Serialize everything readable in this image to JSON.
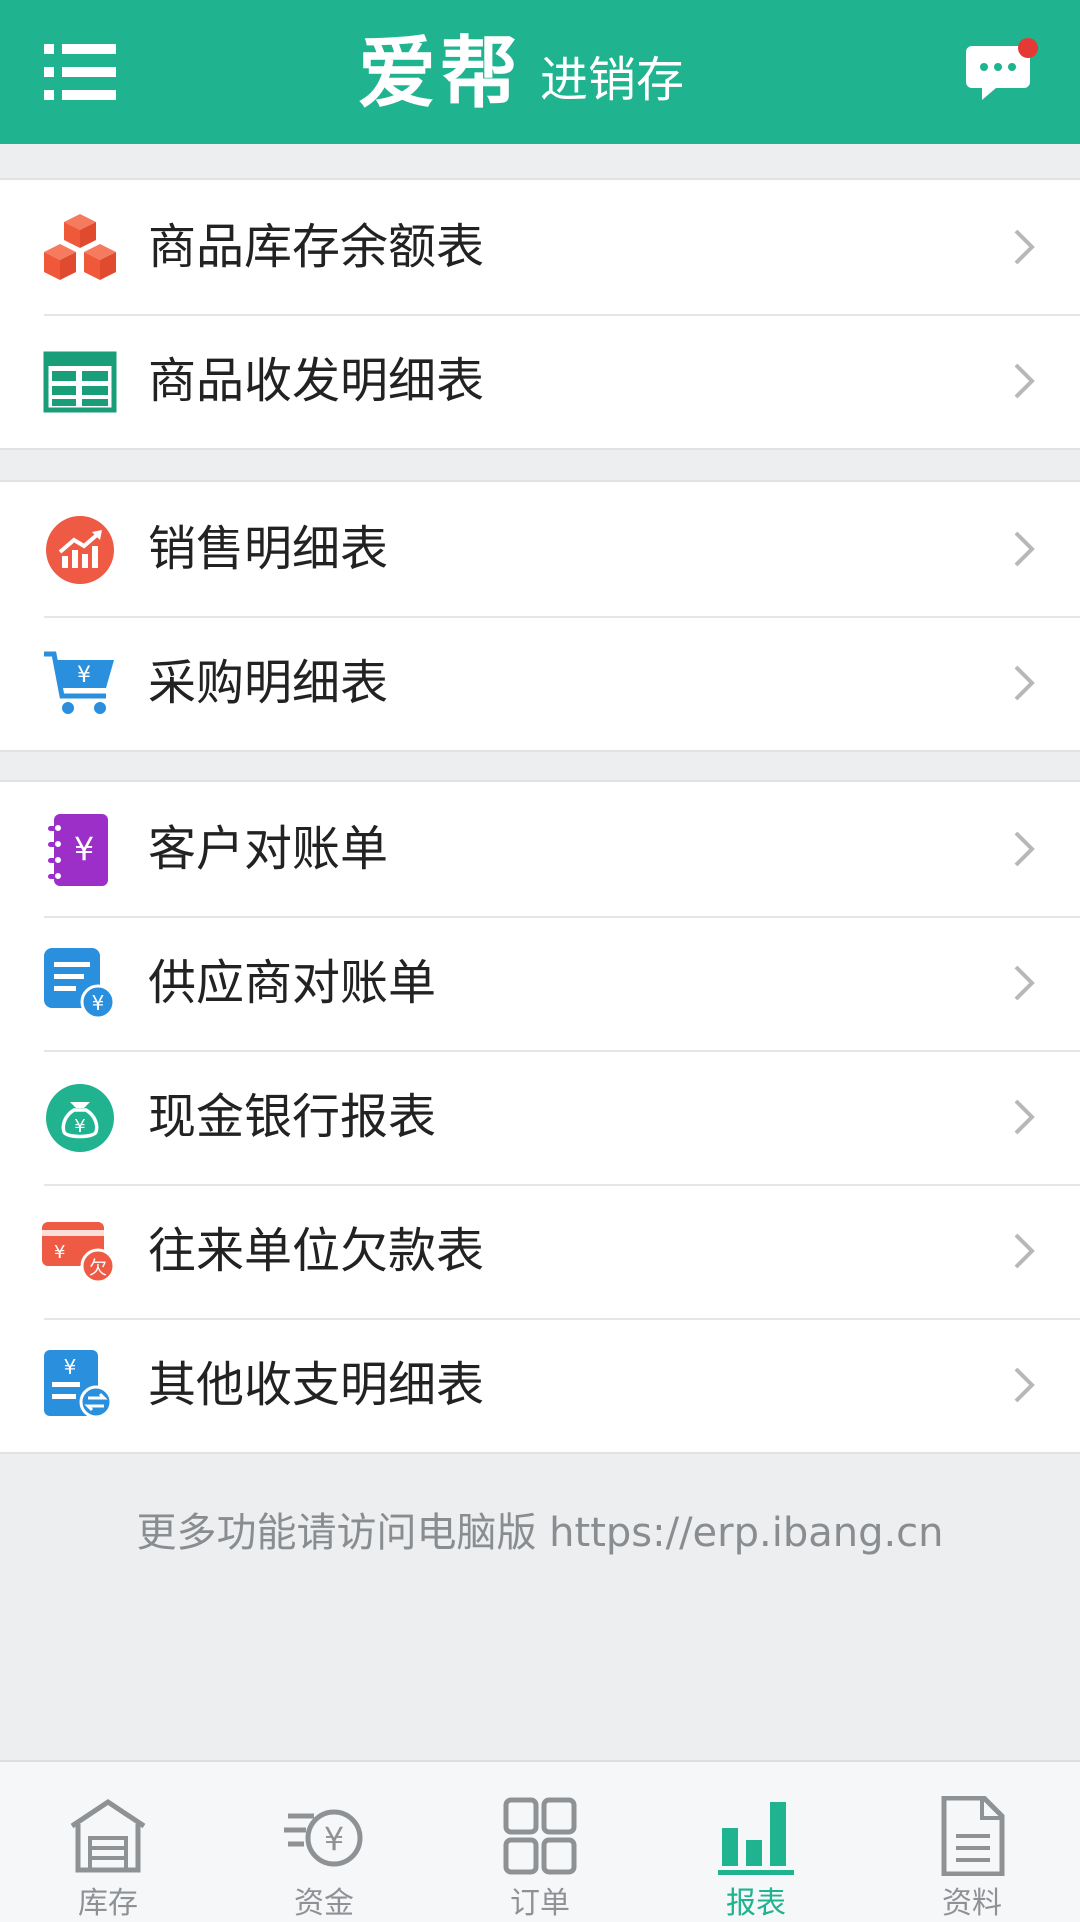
{
  "header": {
    "brand": "爱帮",
    "subtitle": "进销存",
    "has_unread": true
  },
  "groups": [
    {
      "items": [
        {
          "label": "商品库存余额表",
          "icon": "boxes-icon"
        },
        {
          "label": "商品收发明细表",
          "icon": "table-grid-icon"
        }
      ]
    },
    {
      "items": [
        {
          "label": "销售明细表",
          "icon": "sales-trend-icon"
        },
        {
          "label": "采购明细表",
          "icon": "shopping-cart-icon"
        }
      ]
    },
    {
      "items": [
        {
          "label": "客户对账单",
          "icon": "customer-ledger-icon"
        },
        {
          "label": "供应商对账单",
          "icon": "supplier-ledger-icon"
        },
        {
          "label": "现金银行报表",
          "icon": "money-bag-icon"
        },
        {
          "label": "往来单位欠款表",
          "icon": "debt-card-icon"
        },
        {
          "label": "其他收支明细表",
          "icon": "other-income-icon"
        }
      ]
    }
  ],
  "footer": {
    "text": "更多功能请访问电脑版 https://erp.ibang.cn"
  },
  "tabs": [
    {
      "label": "库存",
      "icon": "warehouse-icon",
      "active": false
    },
    {
      "label": "资金",
      "icon": "funds-icon",
      "active": false
    },
    {
      "label": "订单",
      "icon": "orders-grid-icon",
      "active": false
    },
    {
      "label": "报表",
      "icon": "report-chart-icon",
      "active": true
    },
    {
      "label": "资料",
      "icon": "document-icon",
      "active": false
    }
  ],
  "colors": {
    "brand": "#1fb38f",
    "orange": "#f0583a",
    "green": "#1a9e7a",
    "red": "#ee5a44",
    "blue": "#2a8fdc",
    "purple": "#9b2fc8",
    "teal": "#21b390",
    "inactive": "#8f9295"
  }
}
